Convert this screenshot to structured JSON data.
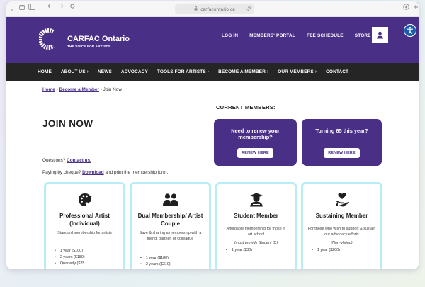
{
  "browser": {
    "url": "carfacontario.ca"
  },
  "site": {
    "brand_name": "CARFAC Ontario",
    "brand_tagline": "THE VOICE FOR ARTISTS",
    "brand_color": "#4a2f86",
    "utility_nav": [
      "LOG IN",
      "MEMBERS' PORTAL",
      "FEE SCHEDULE",
      "STORE"
    ],
    "main_nav": [
      "HOME",
      "ABOUT US",
      "NEWS",
      "ADVOCACY",
      "TOOLS FOR ARTISTS",
      "BECOME A MEMBER",
      "OUR MEMBERS",
      "CONTACT"
    ]
  },
  "breadcrumb": {
    "home": "Home",
    "become": "Become a Member",
    "sep": "›",
    "current": "Join Now"
  },
  "page": {
    "title": "JOIN NOW",
    "questions_prefix": "Questions?",
    "questions_link": "Contact us.",
    "cheque_prefix": "Paying by cheque?",
    "cheque_link": "Download",
    "cheque_suffix": "and print the membership form."
  },
  "current_members": {
    "heading": "CURRENT MEMBERS:",
    "cards": [
      {
        "question": "Need to renew your membership?",
        "button": "RENEW HERE"
      },
      {
        "question": "Turning 65 this year?",
        "button": "RENEW HERE"
      }
    ]
  },
  "plans": [
    {
      "icon": "palette-icon",
      "name": "Professional Artist (Individual)",
      "description": "Standard membership for artists",
      "note": "",
      "prices": [
        "1 year ($100)",
        "2 years ($180)",
        "Quarterly ($25"
      ]
    },
    {
      "icon": "couple-icon",
      "name": "Dual Membership/ Artist Couple",
      "description": "Save & sharing a membership with a friend, partner, or colleague",
      "note": "",
      "prices": [
        "1 year ($180)",
        "2 years ($310)"
      ]
    },
    {
      "icon": "student-icon",
      "name": "Student Member",
      "description": "Affordable membership for those in art school",
      "note": "(must provide Student ID)",
      "prices": [
        "1 year ($30)"
      ]
    },
    {
      "icon": "heart-hand-icon",
      "name": "Sustaining Member",
      "description": "For those who wish to support & sustain our advocacy efforts",
      "note": "(Non-Voting)",
      "prices": [
        "1 year ($200)"
      ]
    }
  ]
}
